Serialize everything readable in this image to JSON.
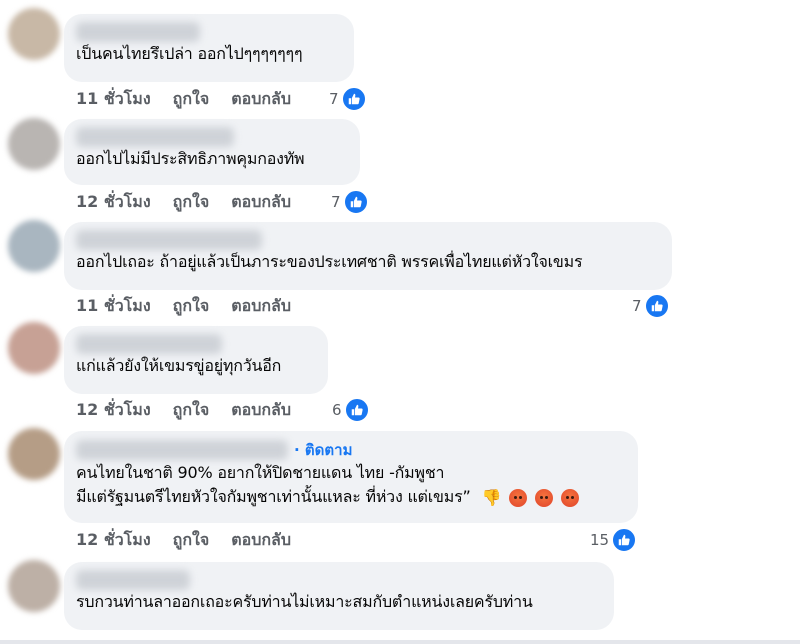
{
  "comments": [
    {
      "text_lines": [
        "เป็นคนไทยรึเปล่า ออกไปๆๆๆๆๆๆๆ"
      ],
      "time": "11 ชั่วโมง",
      "like_label": "ถูกใจ",
      "reply_label": "ตอบกลับ",
      "reaction_count": "7",
      "avatar_color": "#c8b8a6"
    },
    {
      "text_lines": [
        "ออกไปไม่มีประสิทธิภาพคุมกองทัพ"
      ],
      "time": "12 ชั่วโมง",
      "like_label": "ถูกใจ",
      "reply_label": "ตอบกลับ",
      "reaction_count": "7",
      "avatar_color": "#b9b5b2"
    },
    {
      "text_lines": [
        "ออกไปเถอะ ถ้าอยู่แล้วเป็นภาระของประเทศชาติ พรรคเพื่อไทยแต่หัวใจเขมร"
      ],
      "time": "11 ชั่วโมง",
      "like_label": "ถูกใจ",
      "reply_label": "ตอบกลับ",
      "reaction_count": "7",
      "avatar_color": "#a9b6c0"
    },
    {
      "text_lines": [
        "แก่แล้วยังให้เขมรขู่อยู่ทุกวันอีก"
      ],
      "time": "12 ชั่วโมง",
      "like_label": "ถูกใจ",
      "reply_label": "ตอบกลับ",
      "reaction_count": "6",
      "avatar_color": "#c7a195"
    },
    {
      "follow_label": "· ติดตาม",
      "text_lines": [
        "คนไทยในชาติ 90% อยากให้ปิดชายแดน ไทย -กัมพูชา",
        "มีแต่รัฐมนตรีไทยหัวใจกัมพูชาเท่านั้นแหละ ที่ห่วง แต่เขมร”"
      ],
      "time": "12 ชั่วโมง",
      "like_label": "ถูกใจ",
      "reply_label": "ตอบกลับ",
      "reaction_count": "15",
      "avatar_color": "#b59d86"
    },
    {
      "text_lines": [
        "รบกวนท่านลาออกเถอะครับท่านไม่เหมาะสมกับตำแหน่งเลยครับท่าน"
      ],
      "avatar_color": "#bdb0a6"
    }
  ],
  "icons": {
    "like": "like-thumbs-up-icon",
    "thumbs_down": "thumbs-down-emoji-icon",
    "angry": "angry-face-emoji-icon"
  },
  "colors": {
    "bubble": "#f0f2f5",
    "like_blue": "#1877f2",
    "meta_text": "#5a5e64"
  }
}
